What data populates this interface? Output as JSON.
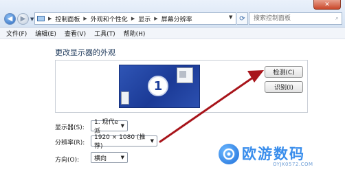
{
  "address_bar": {
    "path": [
      "控制面板",
      "外观和个性化",
      "显示",
      "屏幕分辨率"
    ],
    "search_placeholder": "搜索控制面板",
    "close_label": "✕"
  },
  "menu": [
    "文件(F)",
    "编辑(E)",
    "查看(V)",
    "工具(T)",
    "帮助(H)"
  ],
  "main": {
    "heading": "更改显示器的外观",
    "monitor_number": "1",
    "detect_button": "检测(C)",
    "identify_button": "识别(I)",
    "display_label": "显示器(S):",
    "display_value": "1. 现代e派",
    "resolution_label": "分辨率(R):",
    "resolution_value": "1920 × 1080 (推荐)",
    "orientation_label": "方向(O):",
    "orientation_value": "横向"
  },
  "watermark": {
    "text": "欧游数码",
    "sub": "OYJK0572.COM"
  },
  "colors": {
    "annotation_arrow": "#a8151b",
    "monitor_blue": "#1f3f9c",
    "watermark_blue": "#3a8eec"
  }
}
